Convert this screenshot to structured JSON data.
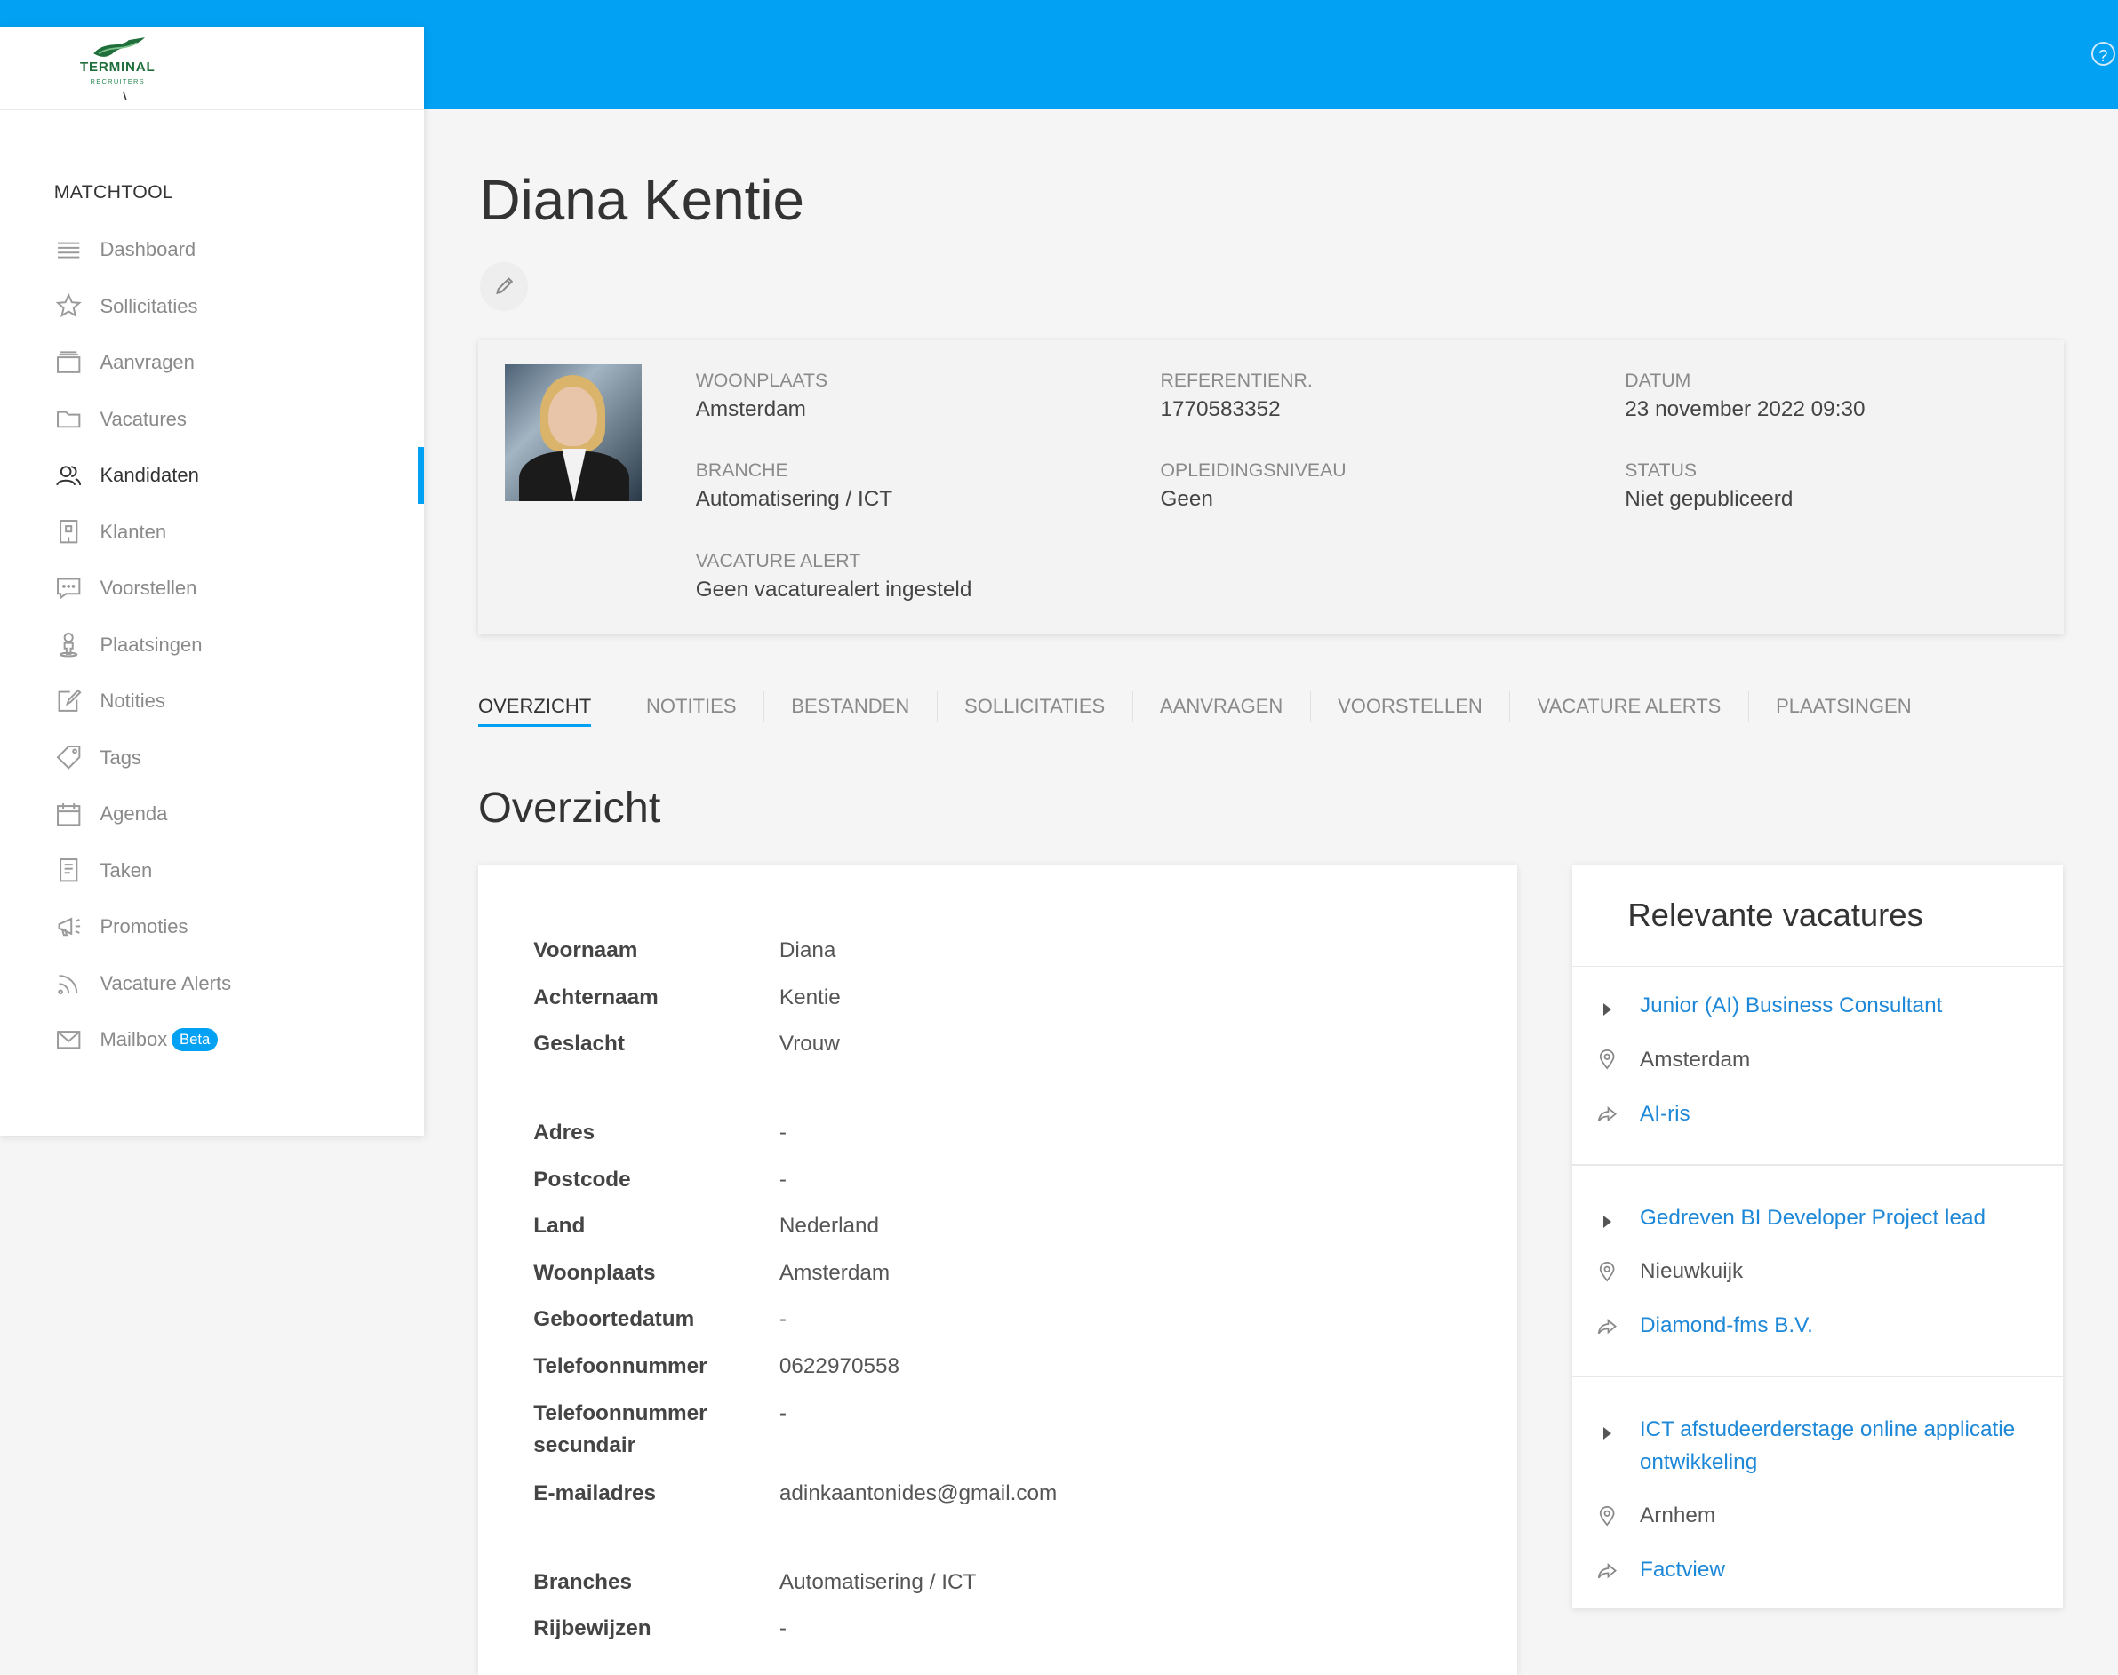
{
  "app": {
    "logo_text": "TERMINAL",
    "logo_sub": "RECRUITERS",
    "help_icon": "question-circle-icon",
    "accent": "#03a1f3"
  },
  "sidebar": {
    "section": "MATCHTOOL",
    "items": [
      {
        "label": "Dashboard",
        "icon": "list-icon"
      },
      {
        "label": "Sollicitaties",
        "icon": "star-icon"
      },
      {
        "label": "Aanvragen",
        "icon": "inbox-icon"
      },
      {
        "label": "Vacatures",
        "icon": "folder-icon"
      },
      {
        "label": "Kandidaten",
        "icon": "users-icon",
        "active": true
      },
      {
        "label": "Klanten",
        "icon": "building-icon"
      },
      {
        "label": "Voorstellen",
        "icon": "chat-icon"
      },
      {
        "label": "Plaatsingen",
        "icon": "person-icon"
      },
      {
        "label": "Notities",
        "icon": "note-edit-icon"
      },
      {
        "label": "Tags",
        "icon": "tag-icon"
      },
      {
        "label": "Agenda",
        "icon": "calendar-icon"
      },
      {
        "label": "Taken",
        "icon": "task-icon"
      },
      {
        "label": "Promoties",
        "icon": "megaphone-icon"
      },
      {
        "label": "Vacature Alerts",
        "icon": "rss-icon"
      },
      {
        "label": "Mailbox",
        "icon": "mail-icon",
        "badge": "Beta"
      }
    ]
  },
  "candidate": {
    "name": "Diana Kentie",
    "woonplaats_label": "WOONPLAATS",
    "woonplaats": "Amsterdam",
    "referentie_label": "REFERENTIENR.",
    "referentie": "1770583352",
    "datum_label": "DATUM",
    "datum": "23 november 2022 09:30",
    "branche_label": "BRANCHE",
    "branche": "Automatisering / ICT",
    "opleiding_label": "OPLEIDINGSNIVEAU",
    "opleiding": "Geen",
    "status_label": "STATUS",
    "status": "Niet gepubliceerd",
    "alert_label": "VACATURE ALERT",
    "alert": "Geen vacaturealert ingesteld"
  },
  "tabs": [
    "OVERZICHT",
    "NOTITIES",
    "BESTANDEN",
    "SOLLICITATIES",
    "AANVRAGEN",
    "VOORSTELLEN",
    "VACATURE ALERTS",
    "PLAATSINGEN"
  ],
  "overview": {
    "title": "Overzicht",
    "rows": [
      {
        "k": "Voornaam",
        "v": "Diana"
      },
      {
        "k": "Achternaam",
        "v": "Kentie"
      },
      {
        "k": "Geslacht",
        "v": "Vrouw"
      },
      {
        "k": "Adres",
        "v": "-"
      },
      {
        "k": "Postcode",
        "v": "-"
      },
      {
        "k": "Land",
        "v": "Nederland"
      },
      {
        "k": "Woonplaats",
        "v": "Amsterdam"
      },
      {
        "k": "Geboortedatum",
        "v": "-"
      },
      {
        "k": "Telefoonnummer",
        "v": "0622970558"
      },
      {
        "k": "Telefoonnummer secundair",
        "v": "-"
      },
      {
        "k": "E-mailadres",
        "v": "adinkaantonides@gmail.com"
      },
      {
        "k": "Branches",
        "v": "Automatisering / ICT"
      },
      {
        "k": "Rijbewijzen",
        "v": "-"
      }
    ]
  },
  "vacatures": {
    "title": "Relevante vacatures",
    "items": [
      {
        "title": "Junior (AI) Business Consultant",
        "location": "Amsterdam",
        "company": "AI-ris"
      },
      {
        "title": "Gedreven BI Developer Project lead",
        "location": "Nieuwkuijk",
        "company": "Diamond-fms B.V."
      },
      {
        "title": "ICT afstudeerderstage online applicatie ontwikkeling",
        "location": "Arnhem",
        "company": "Factview"
      }
    ]
  }
}
